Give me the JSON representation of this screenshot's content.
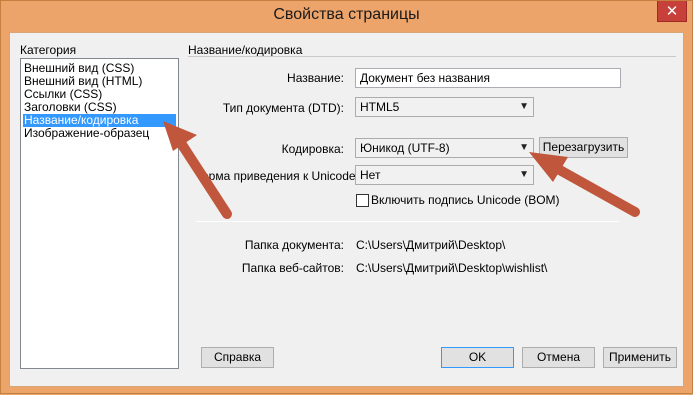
{
  "window": {
    "title": "Свойства страницы",
    "close_glyph": "✕"
  },
  "category": {
    "label": "Категория",
    "items": [
      {
        "label": "Внешний вид (CSS)",
        "selected": false
      },
      {
        "label": "Внешний вид (HTML)",
        "selected": false
      },
      {
        "label": "Ссылки (CSS)",
        "selected": false
      },
      {
        "label": "Заголовки (CSS)",
        "selected": false
      },
      {
        "label": "Название/кодировка",
        "selected": true
      },
      {
        "label": "Изображение-образец",
        "selected": false
      }
    ]
  },
  "section": {
    "title": "Название/кодировка",
    "name_label": "Название:",
    "name_value": "Документ без названия",
    "doctype_label": "Тип документа (DTD):",
    "doctype_value": "HTML5",
    "encoding_label": "Кодировка:",
    "encoding_value": "Юникод (UTF-8)",
    "reload_button": "Перезагрузить",
    "normalization_label": "орма приведения к Unicode:",
    "normalization_value": "Нет",
    "bom_label": "Включить подпись Unicode (BOM)",
    "bom_checked": false,
    "doc_folder_label": "Папка документа:",
    "doc_folder_value": "C:\\Users\\Дмитрий\\Desktop\\",
    "site_folder_label": "Папка веб-сайтов:",
    "site_folder_value": "C:\\Users\\Дмитрий\\Desktop\\wishlist\\"
  },
  "buttons": {
    "help": "Справка",
    "ok": "OK",
    "cancel": "Отмена",
    "apply": "Применить"
  },
  "colors": {
    "frame": "#eda46a",
    "selection": "#3399ff",
    "close_button": "#c7403a",
    "annotation_arrow": "#c0563b"
  }
}
